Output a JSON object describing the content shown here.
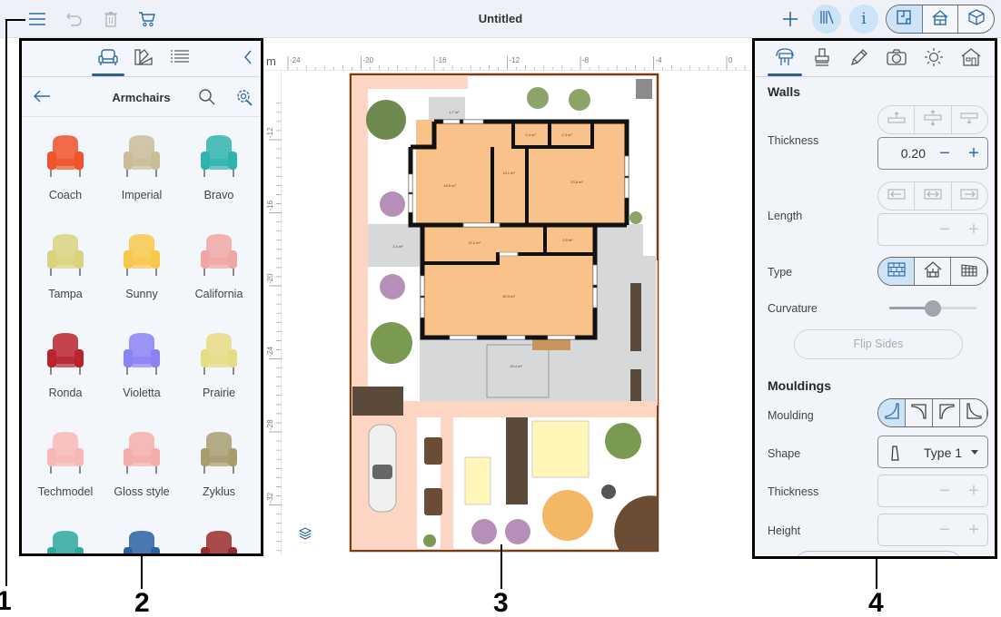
{
  "topbar": {
    "title": "Untitled",
    "left_icons": [
      "menu-icon",
      "undo-icon",
      "trash-icon",
      "cart-icon"
    ],
    "right_icons": [
      "plus-icon",
      "library-icon",
      "info-icon"
    ],
    "view_modes": [
      {
        "name": "floor-plan-2d",
        "active": true
      },
      {
        "name": "house-3d-front",
        "active": false
      },
      {
        "name": "house-3d-iso",
        "active": false
      }
    ]
  },
  "left_panel": {
    "tabs": [
      {
        "name": "furniture",
        "active": true
      },
      {
        "name": "materials",
        "active": false
      },
      {
        "name": "list",
        "active": false
      }
    ],
    "header": {
      "title": "Armchairs"
    },
    "items": [
      {
        "label": "Coach",
        "color": "#f0522a"
      },
      {
        "label": "Imperial",
        "color": "#c9bd98"
      },
      {
        "label": "Bravo",
        "color": "#2fb3ad"
      },
      {
        "label": "Tampa",
        "color": "#d8d47c"
      },
      {
        "label": "Sunny",
        "color": "#f8c84a"
      },
      {
        "label": "California",
        "color": "#f0a7a3"
      },
      {
        "label": "Ronda",
        "color": "#b8232d"
      },
      {
        "label": "Violetta",
        "color": "#8a82f2"
      },
      {
        "label": "Prairie",
        "color": "#e6dc84"
      },
      {
        "label": "Techmodel",
        "color": "#f7b8b4"
      },
      {
        "label": "Gloss style",
        "color": "#f4aeaa"
      },
      {
        "label": "Zyklus",
        "color": "#a79d6d"
      },
      {
        "label": "",
        "color": "#2fa89c"
      },
      {
        "label": "",
        "color": "#2c5fa3"
      },
      {
        "label": "",
        "color": "#9a2a2a"
      }
    ]
  },
  "canvas": {
    "unit": "m",
    "ruler_x_labels": [
      "-24",
      "-20",
      "-16",
      "-12",
      "-8",
      "-4",
      "0"
    ],
    "ruler_y_labels": [
      "-12",
      "-16",
      "-20",
      "-24",
      "-28",
      "-32"
    ],
    "rooms": [
      {
        "label": "18.0 m²"
      },
      {
        "label": "13.1 m²"
      },
      {
        "label": "23.6 m²"
      },
      {
        "label": "2.4 m²"
      },
      {
        "label": "2.3 m²"
      },
      {
        "label": "12.1 m²"
      },
      {
        "label": "3.5 m²"
      },
      {
        "label": "30.3 m²"
      },
      {
        "label": "3.4 m²"
      },
      {
        "label": "20.4 m²"
      },
      {
        "label": "1.7 m²"
      }
    ],
    "layers_icon": "layers-icon"
  },
  "right_panel": {
    "tabs": [
      {
        "name": "walls-tool",
        "active": true
      },
      {
        "name": "paint-tool",
        "active": false
      },
      {
        "name": "pencil-tool",
        "active": false
      },
      {
        "name": "camera-tool",
        "active": false
      },
      {
        "name": "light-tool",
        "active": false
      },
      {
        "name": "house-tool",
        "active": false
      }
    ],
    "walls": {
      "title": "Walls",
      "thickness_label": "Thickness",
      "thickness_value": "0.20",
      "length_label": "Length",
      "length_value": "",
      "type_label": "Type",
      "curvature_label": "Curvature",
      "curvature_value": 0.5,
      "flip_label": "Flip Sides"
    },
    "mouldings": {
      "title": "Mouldings",
      "moulding_label": "Moulding",
      "shape_label": "Shape",
      "shape_value": "Type 1",
      "thickness_label": "Thickness",
      "height_label": "Height"
    }
  },
  "callouts": [
    "1",
    "2",
    "3",
    "4"
  ],
  "colors": {
    "accent": "#2f6aa3",
    "room_fill": "#f9c28a",
    "path_fill": "#fdd6c3",
    "paving": "#d6d8da",
    "active_bg": "#cde3f8"
  }
}
